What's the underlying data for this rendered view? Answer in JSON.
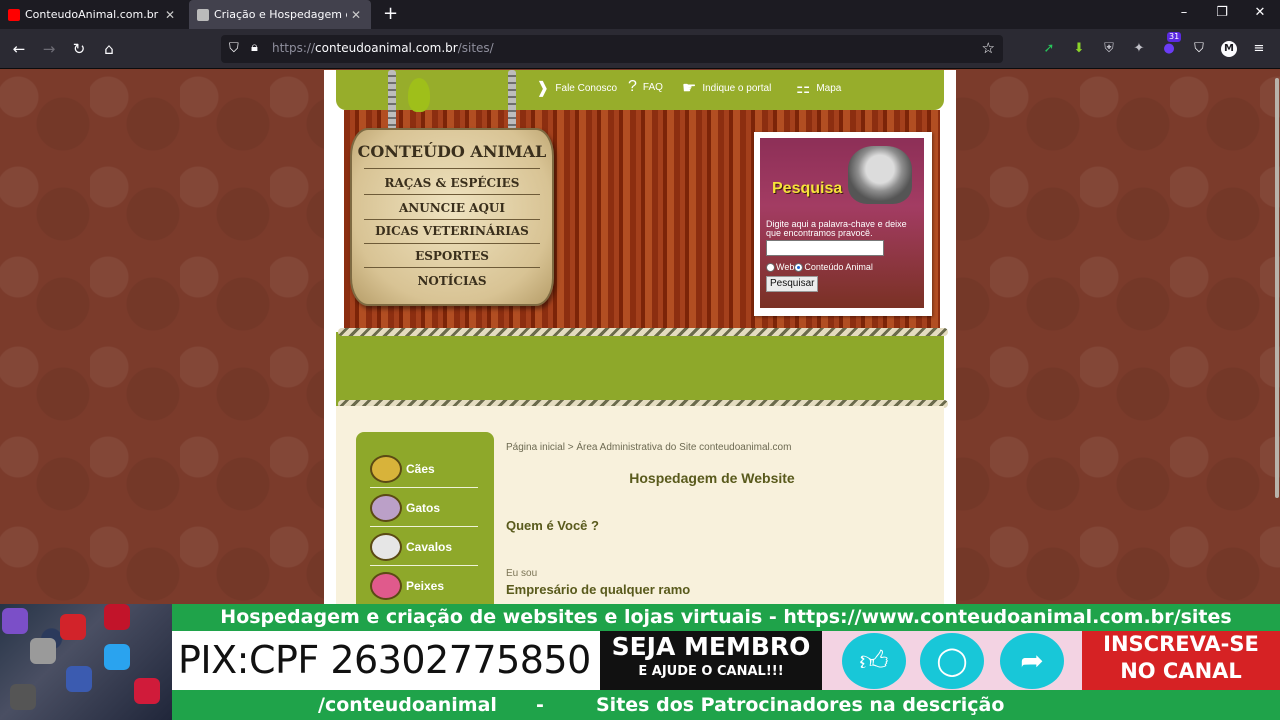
{
  "browser": {
    "tabs": [
      {
        "title": "ConteudoAnimal.com.br - YouTube",
        "active": false
      },
      {
        "title": "Criação e Hospedagem de Website",
        "active": true
      }
    ],
    "new_tab_label": "+",
    "url": {
      "scheme": "https://",
      "host": "conteudoanimal.com.br",
      "path": "/sites/"
    },
    "extension_badge": "31",
    "profile_initial": "M"
  },
  "site": {
    "topnav": [
      "Fale Conosco",
      "FAQ",
      "Indique o portal",
      "Mapa"
    ],
    "sign": {
      "title": "CONTEÚDO ANIMAL",
      "items": [
        "RAÇAS & ESPÉCIES",
        "ANUNCIE AQUI",
        "DICAS VETERINÁRIAS",
        "ESPORTES",
        "NOTÍCIAS"
      ]
    },
    "search": {
      "title": "Pesquisa",
      "description": "Digite aqui a palavra-chave e deixe que encontramos pravocê.",
      "option_web": "Web",
      "option_site": "Conteúdo Animal",
      "button": "Pesquisar"
    },
    "categories": [
      "Cães",
      "Gatos",
      "Cavalos",
      "Peixes"
    ],
    "breadcrumb": "Página inicial > Área Administrativa do Site conteudoanimal.com",
    "page_title": "Hospedagem de Website",
    "question": "Quem é Você ?",
    "eu_sou": "Eu sou",
    "role": "Empresário de qualquer ramo"
  },
  "banner": {
    "line1": "Hospedagem e criação de websites e lojas virtuais - https://www.conteudoanimal.com.br/sites",
    "pix": "PIX:CPF 26302775850",
    "membro_a": "SEJA MEMBRO",
    "membro_b": "E AJUDE O CANAL!!!",
    "inscreva_a": "INSCREVA-SE",
    "inscreva_b": "NO CANAL",
    "line3_left": "/conteudoanimal",
    "line3_sep": "-",
    "line3_right": "Sites dos Patrocinadores na descrição"
  },
  "colors": {
    "site_green": "#8ea82a",
    "title_olive": "#595a1c",
    "banner_green": "#1fa34a"
  }
}
